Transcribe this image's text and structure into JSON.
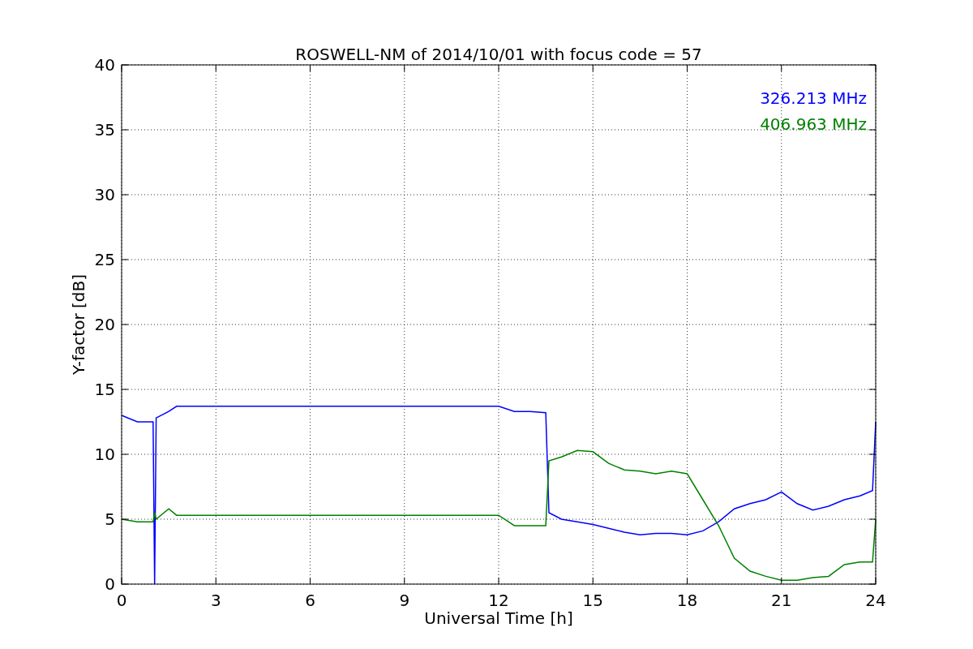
{
  "chart": {
    "chart_data": {
      "type": "line",
      "title": "ROSWELL-NM of 2014/10/01 with focus code = 57",
      "xlabel": "Universal Time [h]",
      "ylabel": "Y-factor [dB]",
      "x": [
        0,
        0.5,
        1,
        1.05,
        1.1,
        1.5,
        1.75,
        3,
        6,
        9,
        12,
        12.5,
        13,
        13.5,
        13.6,
        14,
        14.5,
        15,
        15.5,
        16,
        16.5,
        17,
        17.5,
        18,
        18.5,
        19,
        19.5,
        20,
        20.5,
        21,
        21.5,
        22,
        22.5,
        23,
        23.5,
        23.9,
        24
      ],
      "series": [
        {
          "name": "326.213 MHz",
          "color": "#0000ff",
          "values": [
            13,
            12.5,
            12.5,
            0,
            12.8,
            13.3,
            13.7,
            13.7,
            13.7,
            13.7,
            13.7,
            13.3,
            13.3,
            13.2,
            5.5,
            5,
            4.8,
            4.6,
            4.3,
            4,
            3.8,
            3.9,
            3.9,
            3.8,
            4.1,
            4.8,
            5.8,
            6.2,
            6.5,
            7.1,
            6.2,
            5.7,
            6,
            6.5,
            6.8,
            7.2,
            12.5
          ]
        },
        {
          "name": "406.963 MHz",
          "color": "#008000",
          "values": [
            5,
            4.8,
            4.8,
            5.5,
            5,
            5.8,
            5.3,
            5.3,
            5.3,
            5.3,
            5.3,
            4.5,
            4.5,
            4.5,
            9.5,
            9.8,
            10.3,
            10.2,
            9.3,
            8.8,
            8.7,
            8.5,
            8.7,
            8.5,
            6.5,
            4.5,
            2,
            1,
            0.6,
            0.3,
            0.3,
            0.5,
            0.6,
            1.5,
            1.7,
            1.7,
            5
          ]
        }
      ],
      "grid": true,
      "xlim": [
        0,
        24
      ],
      "ylim": [
        0,
        40
      ],
      "xticks": [
        0,
        3,
        6,
        9,
        12,
        15,
        18,
        21,
        24
      ],
      "yticks": [
        0,
        5,
        10,
        15,
        20,
        25,
        30,
        35,
        40
      ]
    }
  }
}
